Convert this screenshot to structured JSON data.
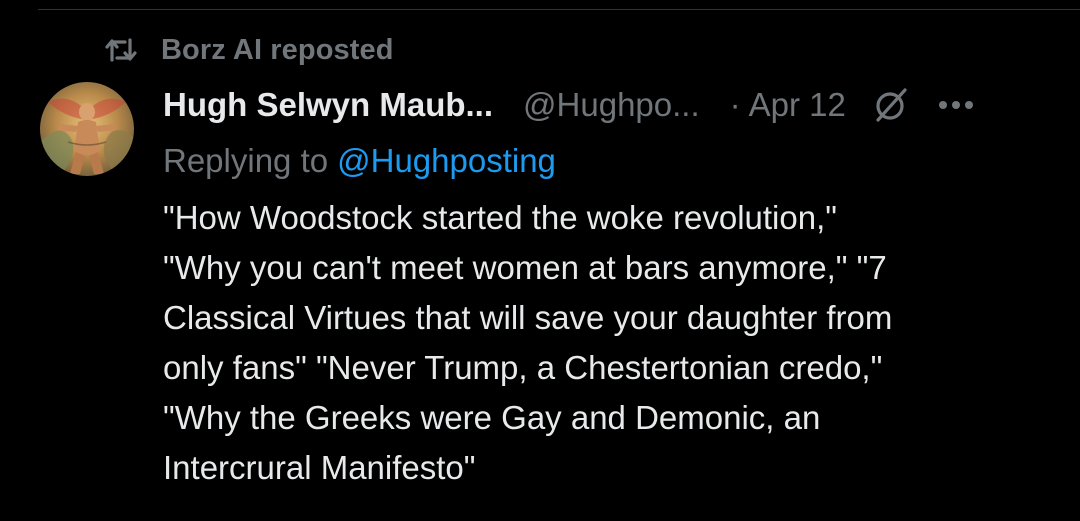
{
  "repost": {
    "text": "Borz AI reposted",
    "icon": "repost-icon"
  },
  "post": {
    "display_name": "Hugh Selwyn Maub...",
    "handle": "@Hughpo...",
    "separator": "·",
    "date": "Apr 12",
    "status_icon": "null-circle-icon",
    "more_icon": "more-dots-icon",
    "reply_prefix": "Replying to",
    "reply_handle": "@Hughposting",
    "body_lines": [
      "\"How Woodstock started the woke revolution,\"",
      "\"Why you can't meet women at bars anymore,\" \"7",
      "Classical Virtues that will save your daughter from",
      "only fans\" \"Never Trump, a Chestertonian credo,\"",
      "\"Why the Greeks were Gay and Demonic, an",
      "Intercrural Manifesto\""
    ]
  },
  "colors": {
    "background": "#000000",
    "primary_text": "#e7e9ea",
    "secondary_text": "#71767b",
    "link": "#1d9bf0",
    "divider": "#2f3336"
  }
}
